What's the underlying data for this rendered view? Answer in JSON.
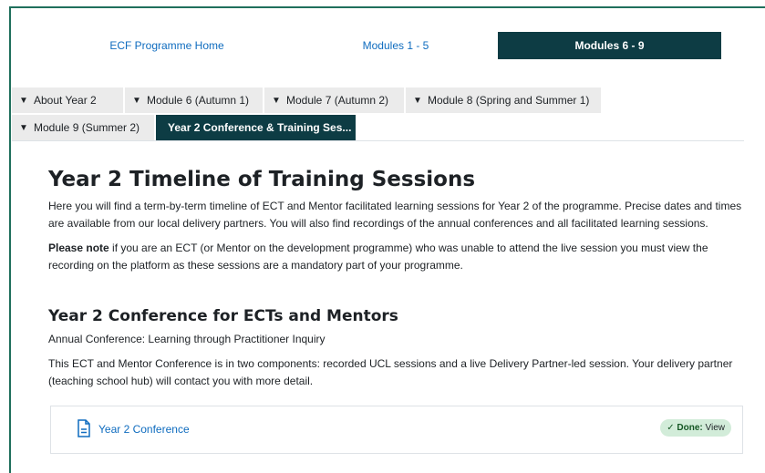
{
  "topnav": {
    "home": "ECF Programme Home",
    "modules_1_5": "Modules 1 - 5",
    "modules_6_9": "Modules 6 - 9"
  },
  "tabs": {
    "row1": [
      "About Year 2",
      "Module 6 (Autumn 1)",
      "Module 7 (Autumn 2)",
      "Module 8 (Spring and Summer 1)"
    ],
    "row2": [
      "Module 9 (Summer 2)"
    ],
    "active": "Year 2 Conference & Training Ses..."
  },
  "main": {
    "title": "Year 2 Timeline of Training Sessions",
    "intro": "Here you will find a term-by-term timeline of ECT and Mentor facilitated learning sessions for Year 2 of the programme. Precise dates and times are available from our local delivery partners. You will also find recordings of the annual conferences and all facilitated learning sessions.",
    "note_bold": "Please note",
    "note_rest": " if you are an ECT (or Mentor on the development programme) who was unable to attend the live session you must view the recording on the platform as these sessions are a mandatory part of your programme.",
    "section_title": "Year 2 Conference for ECTs and Mentors",
    "section_subtitle": "Annual Conference: Learning through Practitioner Inquiry",
    "section_text": "This ECT and Mentor Conference is in two components: recorded UCL sessions and a live Delivery Partner-led session. Your delivery partner (teaching school hub) will contact you with more detail."
  },
  "activity": {
    "icon": "document-icon",
    "title": "Year 2 Conference",
    "badge_done": "✓ Done:",
    "badge_view": " View"
  },
  "colors": {
    "accent": "#0d3c44",
    "link": "#0f6cbf",
    "frame": "#1f6f5c",
    "done_bg": "#d2ecd9"
  }
}
